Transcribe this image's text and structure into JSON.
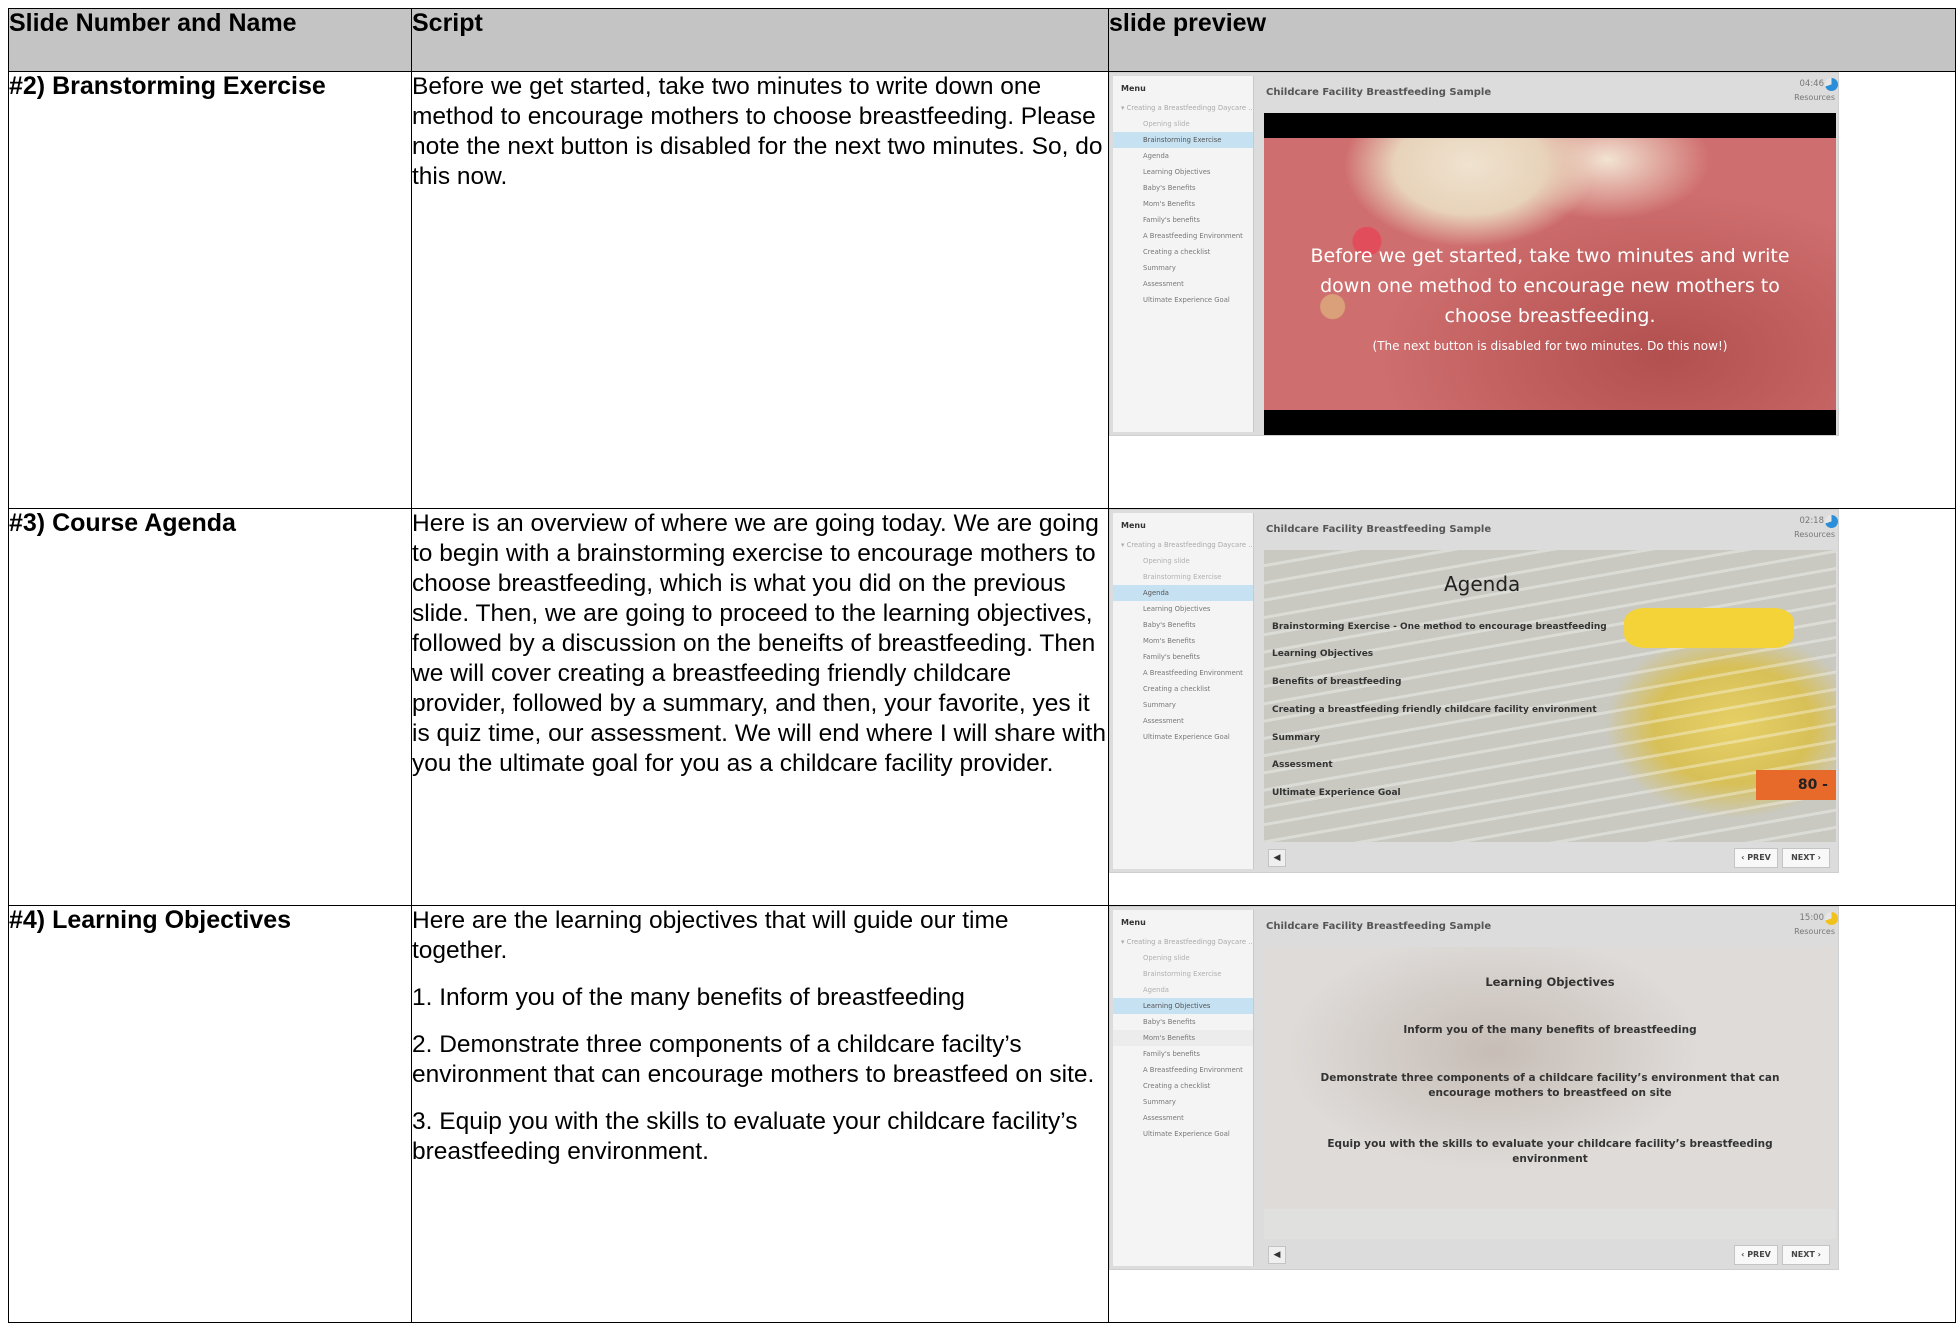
{
  "headers": [
    "Slide Number and Name",
    "Script",
    "slide preview"
  ],
  "menu_title": "Menu",
  "course_title": "Childcare Facility Breastfeeding Sample",
  "resources_label": "Resources",
  "prev_label": "‹ PREV",
  "next_label": "NEXT ›",
  "volume_icon": "speaker-icon",
  "rows": [
    {
      "name": "#2) Branstorming Exercise",
      "script": [
        "Before we get started, take two minutes to write down one method to encourage mothers to choose breastfeeding. Please note the next button is disabled for the next two minutes. So, do this now."
      ],
      "preview": {
        "timer": "04:46",
        "clock_color": "#2a8fd8",
        "menu": [
          "Creating a Breastfeedingg Daycare ...",
          "Opening slide",
          "Brainstorming Exercise",
          "Agenda",
          "Learning Objectives",
          "Baby's Benefits",
          "Mom's Benefits",
          "Family's benefits",
          "A Breastfeeding Environment",
          "Creating a checklist",
          "Summary",
          "Assessment",
          "Ultimate Experience Goal"
        ],
        "active_index": 2,
        "slide_text": "Before we get started, take two minutes and write down one method to encourage new mothers to choose breastfeeding.",
        "slide_subtext": "(The next button is disabled for two minutes. Do this now!)"
      }
    },
    {
      "name": "#3) Course Agenda",
      "script": [
        "Here is an overview of where we are going today. We are going to begin with a brainstorming exercise to encourage mothers to choose breastfeeding, which is what you did on the previous slide. Then, we are going to proceed to the learning objectives, followed by a discussion on the beneifts of breastfeeding. Then we will cover creating a breastfeeding friendly childcare provider, followed by a summary, and then, your favorite, yes it is quiz time, our assessment. We will end where I will share with you the ultimate goal for you as a childcare facility provider."
      ],
      "preview": {
        "timer": "02:18",
        "clock_color": "#2a8fd8",
        "menu": [
          "Creating a Breastfeedingg Daycare ...",
          "Opening slide",
          "Brainstorming Exercise",
          "Agenda",
          "Learning Objectives",
          "Baby's Benefits",
          "Mom's Benefits",
          "Family's benefits",
          "A Breastfeeding Environment",
          "Creating a checklist",
          "Summary",
          "Assessment",
          "Ultimate Experience Goal"
        ],
        "active_index": 3,
        "slide_heading": "Agenda",
        "agenda_items": [
          "Brainstorming Exercise - One method to encourage breastfeeding",
          "Learning Objectives",
          "Benefits of breastfeeding",
          "Creating a breastfeeding friendly childcare facility environment",
          "Summary",
          "Assessment",
          "Ultimate Experience Goal"
        ],
        "jar_label": "80 -"
      }
    },
    {
      "name": "#4) Learning Objectives",
      "script": [
        "Here are the learning objectives that will guide our time together.",
        "1. Inform you of the many benefits of breastfeeding",
        "2. Demonstrate three components of a childcare facilty’s environment that can encourage mothers to breastfeed on site.",
        "3. Equip you with the skills to evaluate your childcare facility’s breastfeeding environment."
      ],
      "preview": {
        "timer": "15:00",
        "clock_color": "#f2c21c",
        "menu": [
          "Creating a Breastfeedingg Daycare ...",
          "Opening slide",
          "Brainstorming Exercise",
          "Agenda",
          "Learning Objectives",
          "Baby's Benefits",
          "Mom's Benefits",
          "Family's benefits",
          "A Breastfeeding Environment",
          "Creating a checklist",
          "Summary",
          "Assessment",
          "Ultimate Experience Goal"
        ],
        "active_index": 4,
        "slide_heading": "Learning Objectives",
        "objectives": [
          "Inform you of the many benefits of breastfeeding",
          "Demonstrate three components of a childcare facility’s environment that can encourage mothers to breastfeed on site",
          "Equip you with the skills to evaluate your childcare facility’s breastfeeding environment"
        ]
      }
    }
  ]
}
